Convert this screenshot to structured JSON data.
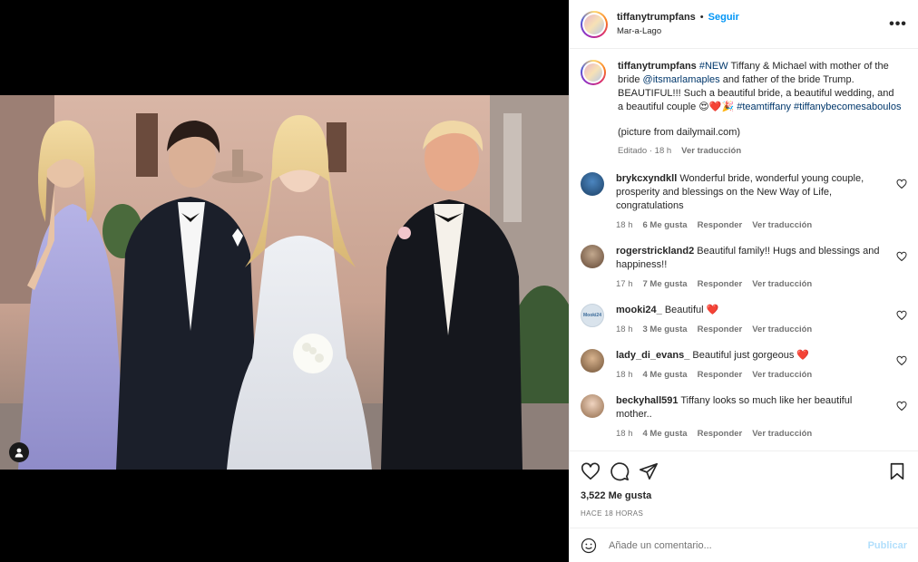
{
  "header": {
    "username": "tiffanytrumpfans",
    "separator": "•",
    "follow_label": "Seguir",
    "location": "Mar-a-Lago",
    "more_label": "•••"
  },
  "caption": {
    "username": "tiffanytrumpfans",
    "hashtag_new": "#NEW",
    "text_1": " Tiffany & Michael with mother of the bride ",
    "mention": "@itsmarlamaples",
    "text_2": " and father of the bride Trump. BEAUTIFUL!!! Such a beautiful bride, a beautiful wedding, and a beautiful couple 😍❤️🎉 ",
    "hashtag_2": "#teamtiffany",
    "hashtag_3": "#tiffanybecomesaboulos",
    "source": "(picture from dailymail.com)",
    "edited": "Editado · 18 h",
    "see_translation": "Ver traducción"
  },
  "comments": [
    {
      "username": "brykcxyndkll",
      "text": "Wonderful bride, wonderful young couple, prosperity and blessings on the New Way of Life, congratulations",
      "time": "18 h",
      "likes": "6 Me gusta",
      "reply": "Responder",
      "translate": "Ver traducción",
      "avatar_color": "#2a5580"
    },
    {
      "username": "rogerstrickland2",
      "text": "Beautiful family!! Hugs and blessings and happiness!!",
      "time": "17 h",
      "likes": "7 Me gusta",
      "reply": "Responder",
      "translate": "Ver traducción",
      "avatar_color": "#8a6f5a"
    },
    {
      "username": "mooki24_",
      "text": "Beautiful ❤️",
      "time": "18 h",
      "likes": "3 Me gusta",
      "reply": "Responder",
      "translate": "Ver traducción",
      "avatar_color": "#d9e3ec",
      "avatar_text": "Mooki24"
    },
    {
      "username": "lady_di_evans_",
      "text": "Beautiful just gorgeous ❤️",
      "time": "18 h",
      "likes": "4 Me gusta",
      "reply": "Responder",
      "translate": "Ver traducción",
      "avatar_color": "#b08a6a"
    },
    {
      "username": "beckyhall591",
      "text": "Tiffany looks so much like her beautiful mother..",
      "time": "18 h",
      "likes": "4 Me gusta",
      "reply": "Responder",
      "translate": "Ver traducción",
      "avatar_color": "#c9a388"
    }
  ],
  "footer": {
    "likes_count": "3,522 Me gusta",
    "time_ago": "HACE 18 HORAS",
    "comment_placeholder": "Añade un comentario...",
    "post_label": "Publicar"
  },
  "colors": {
    "accent": "#0095f6",
    "link": "#00376b",
    "muted": "#737373",
    "heart": "#ed4956"
  }
}
